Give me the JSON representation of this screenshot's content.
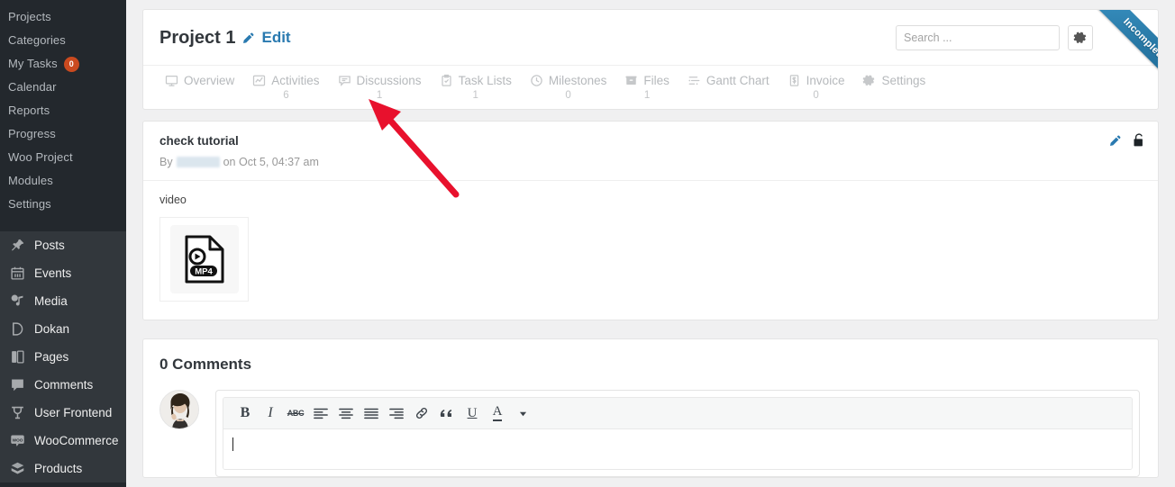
{
  "sidebar": {
    "submenu": [
      {
        "label": "Projects",
        "badge": null
      },
      {
        "label": "Categories",
        "badge": null
      },
      {
        "label": "My Tasks",
        "badge": "0"
      },
      {
        "label": "Calendar",
        "badge": null
      },
      {
        "label": "Reports",
        "badge": null
      },
      {
        "label": "Progress",
        "badge": null
      },
      {
        "label": "Woo Project",
        "badge": null
      },
      {
        "label": "Modules",
        "badge": null
      },
      {
        "label": "Settings",
        "badge": null
      }
    ],
    "main": [
      {
        "label": "Posts",
        "icon": "pin-icon"
      },
      {
        "label": "Events",
        "icon": "calendar-icon"
      },
      {
        "label": "Media",
        "icon": "media-icon"
      },
      {
        "label": "Dokan",
        "icon": "dokan-icon"
      },
      {
        "label": "Pages",
        "icon": "pages-icon"
      },
      {
        "label": "Comments",
        "icon": "comment-bubble-icon"
      },
      {
        "label": "User Frontend",
        "icon": "user-frontend-icon"
      }
    ],
    "main2": [
      {
        "label": "WooCommerce",
        "icon": "woocommerce-icon"
      },
      {
        "label": "Products",
        "icon": "products-box-icon"
      }
    ]
  },
  "project": {
    "title": "Project 1",
    "edit_label": "Edit",
    "ribbon_label": "Incomplete",
    "search_placeholder": "Search ...",
    "search_value": "",
    "settings_icon": "gear-icon",
    "edit_icon": "pencil-icon"
  },
  "tabs": [
    {
      "label": "Overview",
      "count": "",
      "icon": "monitor-icon",
      "active": false
    },
    {
      "label": "Activities",
      "count": "6",
      "icon": "activity-chart-icon",
      "active": false
    },
    {
      "label": "Discussions",
      "count": "1",
      "icon": "discussion-bubble-icon",
      "active": true
    },
    {
      "label": "Task Lists",
      "count": "1",
      "icon": "clipboard-check-icon",
      "active": false
    },
    {
      "label": "Milestones",
      "count": "0",
      "icon": "milestone-clock-icon",
      "active": false
    },
    {
      "label": "Files",
      "count": "1",
      "icon": "files-box-icon",
      "active": false
    },
    {
      "label": "Gantt Chart",
      "count": "",
      "icon": "gantt-bars-icon",
      "active": false
    },
    {
      "label": "Invoice",
      "count": "0",
      "icon": "invoice-dollar-icon",
      "active": false
    },
    {
      "label": "Settings",
      "count": "",
      "icon": "gear-icon",
      "active": false
    }
  ],
  "discussion": {
    "title": "check tutorial",
    "by_prefix": "By",
    "author": "",
    "date_text": "on Oct 5, 04:37 am",
    "edit_icon": "pencil-icon",
    "lock_icon": "unlock-icon",
    "body_text": "video",
    "attachment": {
      "type": "MP4",
      "icon": "mp4-file-icon"
    }
  },
  "comments": {
    "heading": "0 Comments",
    "avatar": "user-avatar",
    "editor_placeholder": "",
    "editor_value": "",
    "toolbar": [
      {
        "name": "bold-button",
        "glyph": "B"
      },
      {
        "name": "italic-button",
        "glyph": "I"
      },
      {
        "name": "strikethrough-button",
        "glyph": "ABC"
      },
      {
        "name": "align-left-button",
        "glyph": "align-left"
      },
      {
        "name": "align-center-button",
        "glyph": "align-center"
      },
      {
        "name": "align-justify-button",
        "glyph": "align-justify"
      },
      {
        "name": "align-right-button",
        "glyph": "align-right"
      },
      {
        "name": "link-button",
        "glyph": "link"
      },
      {
        "name": "blockquote-button",
        "glyph": "quote"
      },
      {
        "name": "underline-button",
        "glyph": "U"
      },
      {
        "name": "text-color-button",
        "glyph": "A"
      },
      {
        "name": "text-color-dropdown",
        "glyph": "caret"
      }
    ]
  },
  "annotation": {
    "type": "red-arrow",
    "color": "#e8112d",
    "points_to": "Discussions"
  },
  "colors": {
    "sidebar_bg": "#23282d",
    "accent_blue": "#2a7ab0",
    "badge_orange": "#ca4a1f",
    "ribbon_blue": "#2878a5",
    "page_bg": "#f0f0f1"
  }
}
